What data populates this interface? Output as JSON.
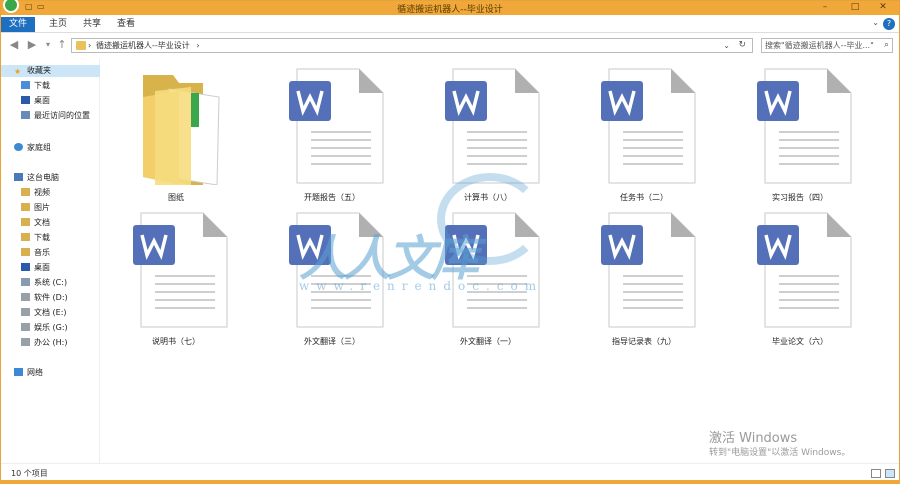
{
  "window": {
    "title": "循迹搬运机器人--毕业设计",
    "min": "–",
    "max": "□",
    "close": "✕"
  },
  "ribbon": {
    "tabs": [
      "文件",
      "主页",
      "共享",
      "查看"
    ],
    "help": "?"
  },
  "address": {
    "path": "循迹搬运机器人--毕业设计",
    "sep": "›",
    "search_placeholder": "搜索\"循迹搬运机器人--毕业...\""
  },
  "sidebar": {
    "favorites_label": "收藏夹",
    "favorites": [
      "下载",
      "桌面",
      "最近访问的位置"
    ],
    "homegroup": "家庭组",
    "pc": "这台电脑",
    "pc_items": [
      "视频",
      "图片",
      "文档",
      "下载",
      "音乐",
      "桌面",
      "系统 (C:)",
      "软件 (D:)",
      "文档 (E:)",
      "娱乐 (G:)",
      "办公 (H:)"
    ],
    "network": "网络"
  },
  "files": [
    {
      "name": "图纸",
      "type": "folder"
    },
    {
      "name": "开题报告（五）",
      "type": "doc"
    },
    {
      "name": "计算书（八）",
      "type": "doc"
    },
    {
      "name": "任务书（二）",
      "type": "doc"
    },
    {
      "name": "实习报告（四）",
      "type": "doc"
    },
    {
      "name": "说明书（七）",
      "type": "doc"
    },
    {
      "name": "外文翻译（三）",
      "type": "doc"
    },
    {
      "name": "外文翻译（一）",
      "type": "doc"
    },
    {
      "name": "指导记录表（九）",
      "type": "doc"
    },
    {
      "name": "毕业论文（六）",
      "type": "doc"
    }
  ],
  "status": {
    "count": "10 个项目"
  },
  "activation": {
    "line1": "激活 Windows",
    "line2": "转到\"电脑设置\"以激活 Windows。"
  },
  "watermark": {
    "text": "人人文库",
    "url": "www.renrendoc.com"
  },
  "colors": {
    "accent": "#f0a83a",
    "file_tab": "#1f6fc0",
    "word_icon": "#5470b8"
  }
}
